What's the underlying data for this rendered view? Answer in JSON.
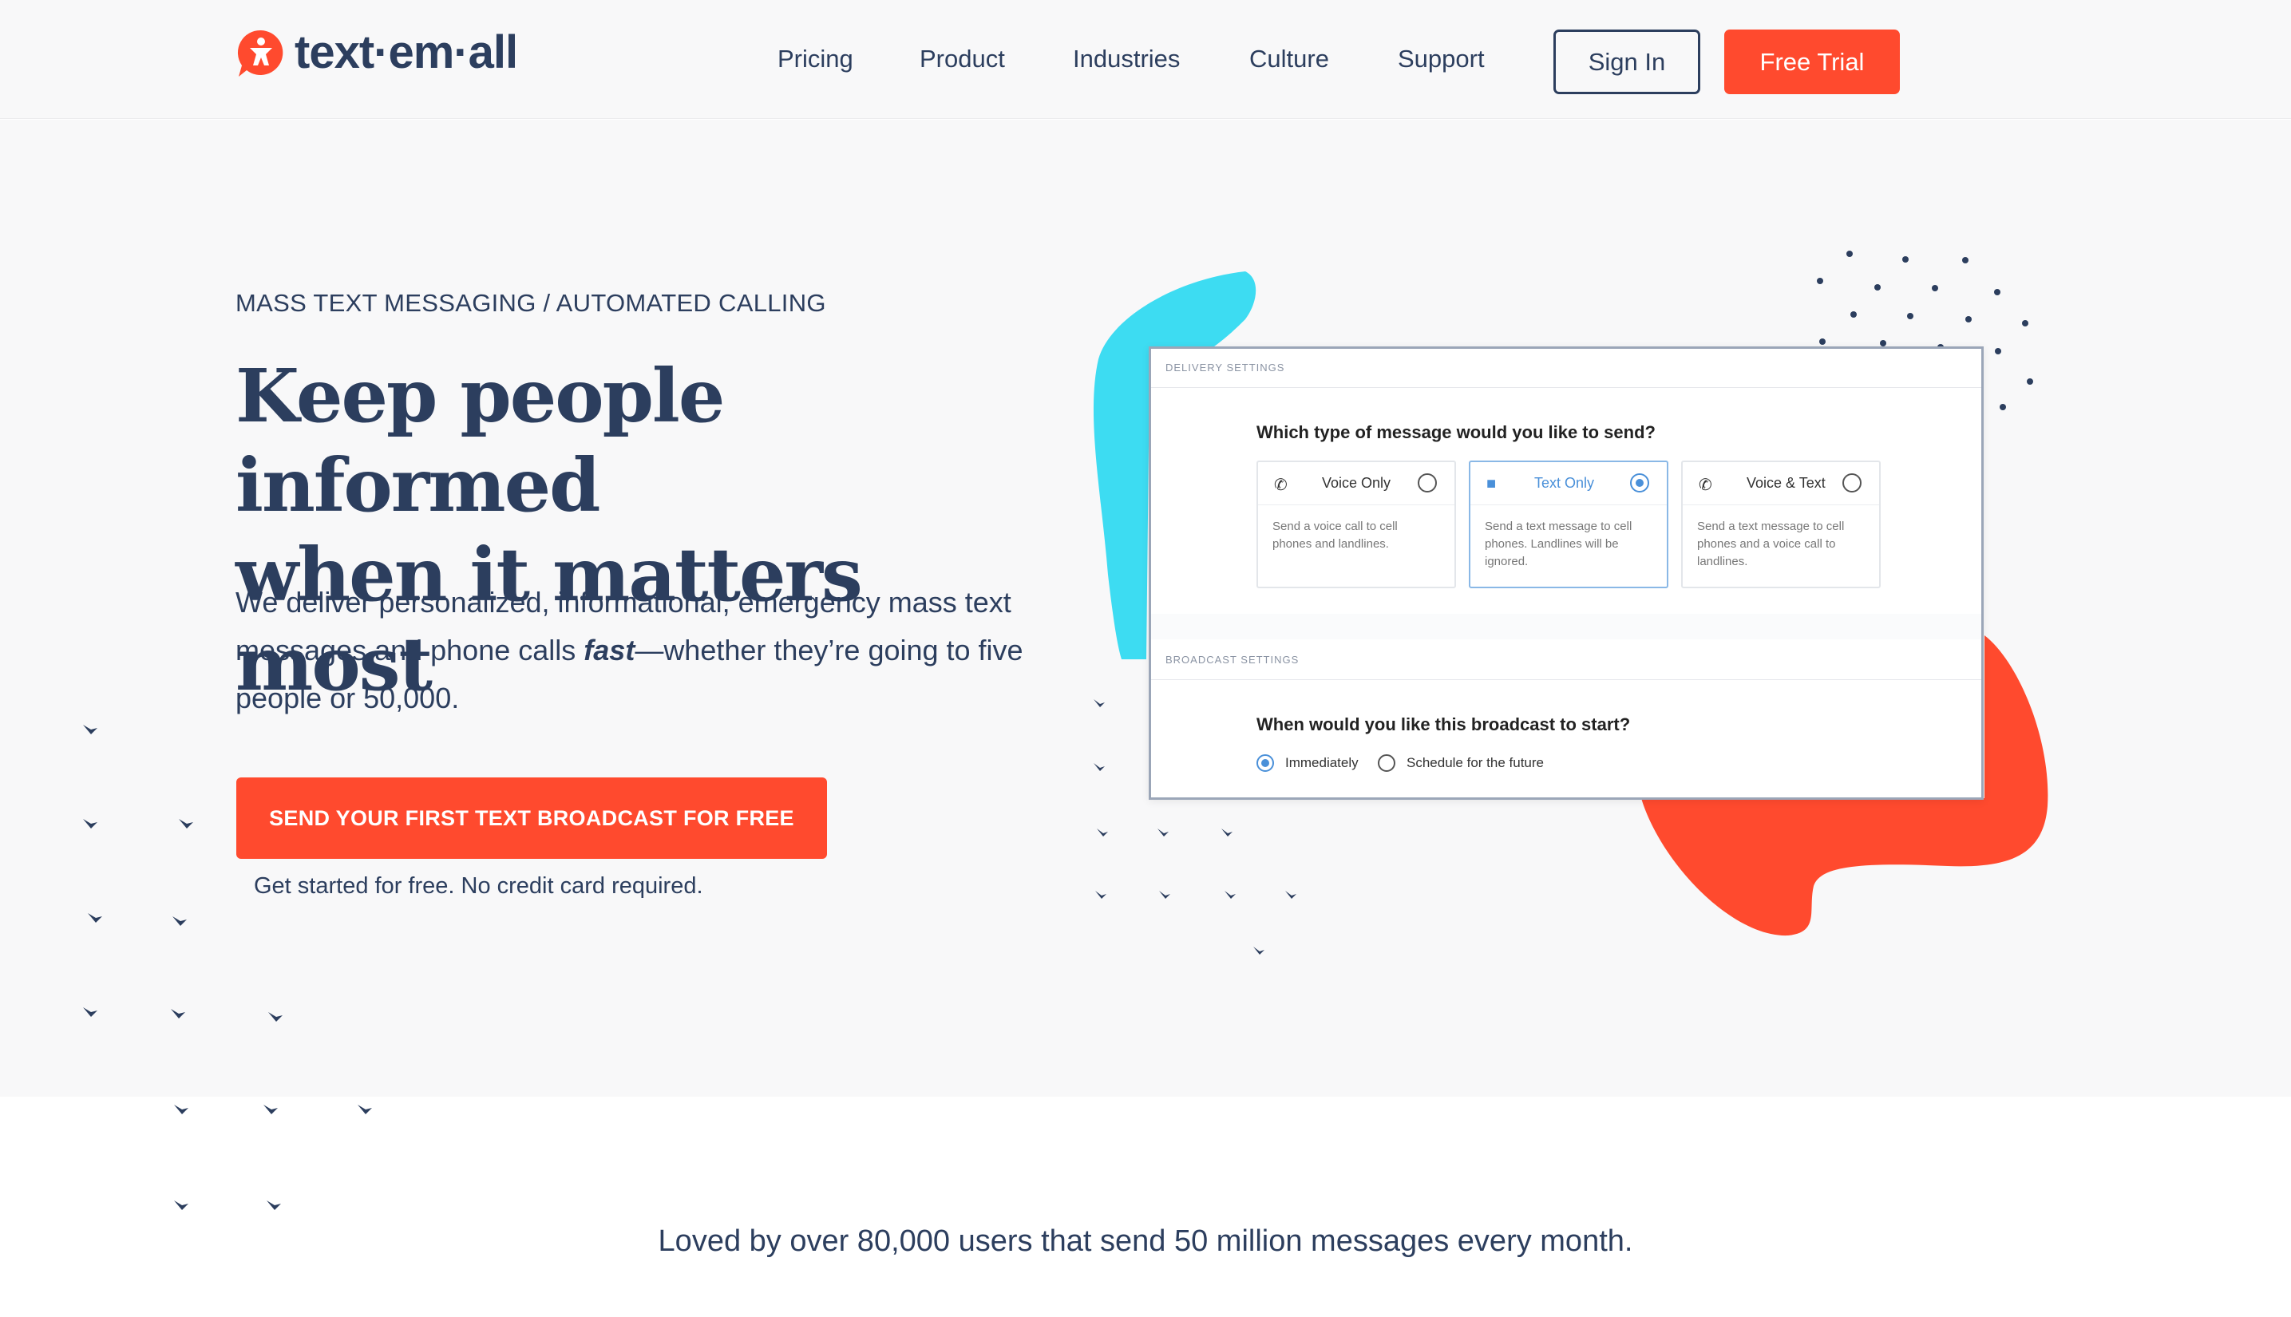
{
  "header": {
    "logo_text": "text·em·all",
    "nav": [
      "Pricing",
      "Product",
      "Industries",
      "Culture",
      "Support"
    ],
    "sign_in": "Sign In",
    "free_trial": "Free Trial"
  },
  "hero": {
    "eyebrow": "MASS TEXT MESSAGING / AUTOMATED CALLING",
    "headline_line1": "Keep people informed",
    "headline_line2": "when it matters most",
    "sub_part1": "We deliver personalized, informational, emergency mass text messages and phone calls ",
    "sub_em": "fast",
    "sub_part2": "—whether they’re going to five people or 50,000.",
    "cta": "SEND YOUR FIRST TEXT BROADCAST FOR FREE",
    "note": "Get started for free. No credit card required."
  },
  "app_panel": {
    "delivery_label": "DELIVERY SETTINGS",
    "question1": "Which type of message would you like to send?",
    "options": [
      {
        "label": "Voice Only",
        "icon": "phone-icon",
        "desc": "Send a voice call to cell phones and landlines.",
        "selected": false
      },
      {
        "label": "Text Only",
        "icon": "message-icon",
        "desc": "Send a text message to cell phones. Landlines will be ignored.",
        "selected": true
      },
      {
        "label": "Voice & Text",
        "icon": "phone-message-icon",
        "desc": "Send a text message to cell phones and a voice call to landlines.",
        "selected": false
      }
    ],
    "broadcast_label": "BROADCAST SETTINGS",
    "question2": "When would you like this broadcast to start?",
    "start_options": [
      "Immediately",
      "Schedule for the future"
    ]
  },
  "tagline": "Loved by over 80,000 users that send 50 million messages every month.",
  "colors": {
    "navy": "#2c3e5e",
    "accent_orange": "#ff4a2e",
    "accent_cyan": "#3ddcf2",
    "selected_blue": "#4a90d9",
    "hero_bg": "#f8f8f9"
  }
}
